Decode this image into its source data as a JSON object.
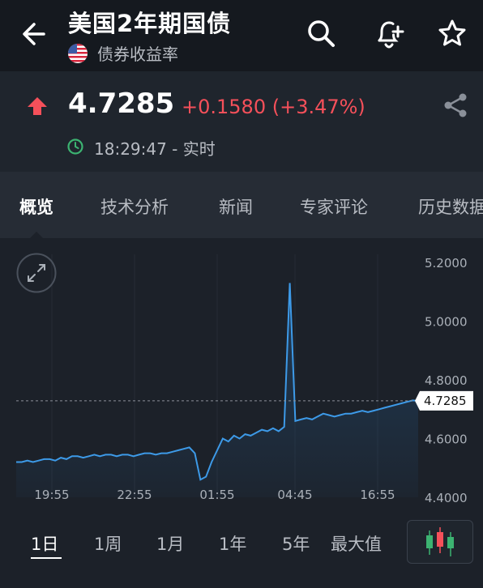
{
  "header": {
    "title": "美国2年期国债",
    "subtitle": "债券收益率",
    "back_icon": "arrow-left-icon",
    "search_icon": "search-icon",
    "alert_icon": "bell-plus-icon",
    "watchlist_icon": "star-icon"
  },
  "quote": {
    "price": "4.7285",
    "change": "+0.1580 (+3.47%)",
    "time": "18:29:47 - 实时",
    "direction_icon": "arrow-up-icon",
    "share_icon": "share-icon",
    "clock_icon": "clock-icon"
  },
  "tabs": [
    {
      "label": "概览",
      "active": true
    },
    {
      "label": "技术分析"
    },
    {
      "label": "新闻"
    },
    {
      "label": "专家评论"
    },
    {
      "label": "历史数据"
    }
  ],
  "periods": [
    {
      "label": "1日",
      "active": true
    },
    {
      "label": "1周"
    },
    {
      "label": "1月"
    },
    {
      "label": "1年"
    },
    {
      "label": "5年"
    },
    {
      "label": "最大值"
    }
  ],
  "chart_data": {
    "type": "area",
    "x_tick_labels": [
      "19:55",
      "22:55",
      "01:55",
      "04:45",
      "16:55"
    ],
    "y_tick_labels": [
      "5.2000",
      "5.0000",
      "4.8000",
      "4.6000",
      "4.4000"
    ],
    "ylim": [
      4.4,
      5.2
    ],
    "current_value": "4.7285",
    "current_value_num": 4.7285,
    "grid": "vertical",
    "series": [
      {
        "values": [
          4.52,
          4.52,
          4.525,
          4.52,
          4.525,
          4.53,
          4.53,
          4.525,
          4.535,
          4.53,
          4.54,
          4.54,
          4.535,
          4.54,
          4.545,
          4.54,
          4.545,
          4.545,
          4.54,
          4.545,
          4.545,
          4.54,
          4.545,
          4.55,
          4.55,
          4.545,
          4.55,
          4.55,
          4.555,
          4.56,
          4.565,
          4.57,
          4.55,
          4.46,
          4.47,
          4.52,
          4.56,
          4.6,
          4.59,
          4.61,
          4.6,
          4.615,
          4.61,
          4.62,
          4.63,
          4.625,
          4.635,
          4.625,
          4.64,
          5.13,
          4.66,
          4.665,
          4.67,
          4.665,
          4.675,
          4.685,
          4.68,
          4.675,
          4.68,
          4.685,
          4.685,
          4.69,
          4.695,
          4.69,
          4.695,
          4.7,
          4.705,
          4.71,
          4.715,
          4.72,
          4.725,
          4.73,
          4.7285
        ],
        "color": "#3d9ae8"
      }
    ],
    "dashed_line_color": "#8a9099"
  }
}
